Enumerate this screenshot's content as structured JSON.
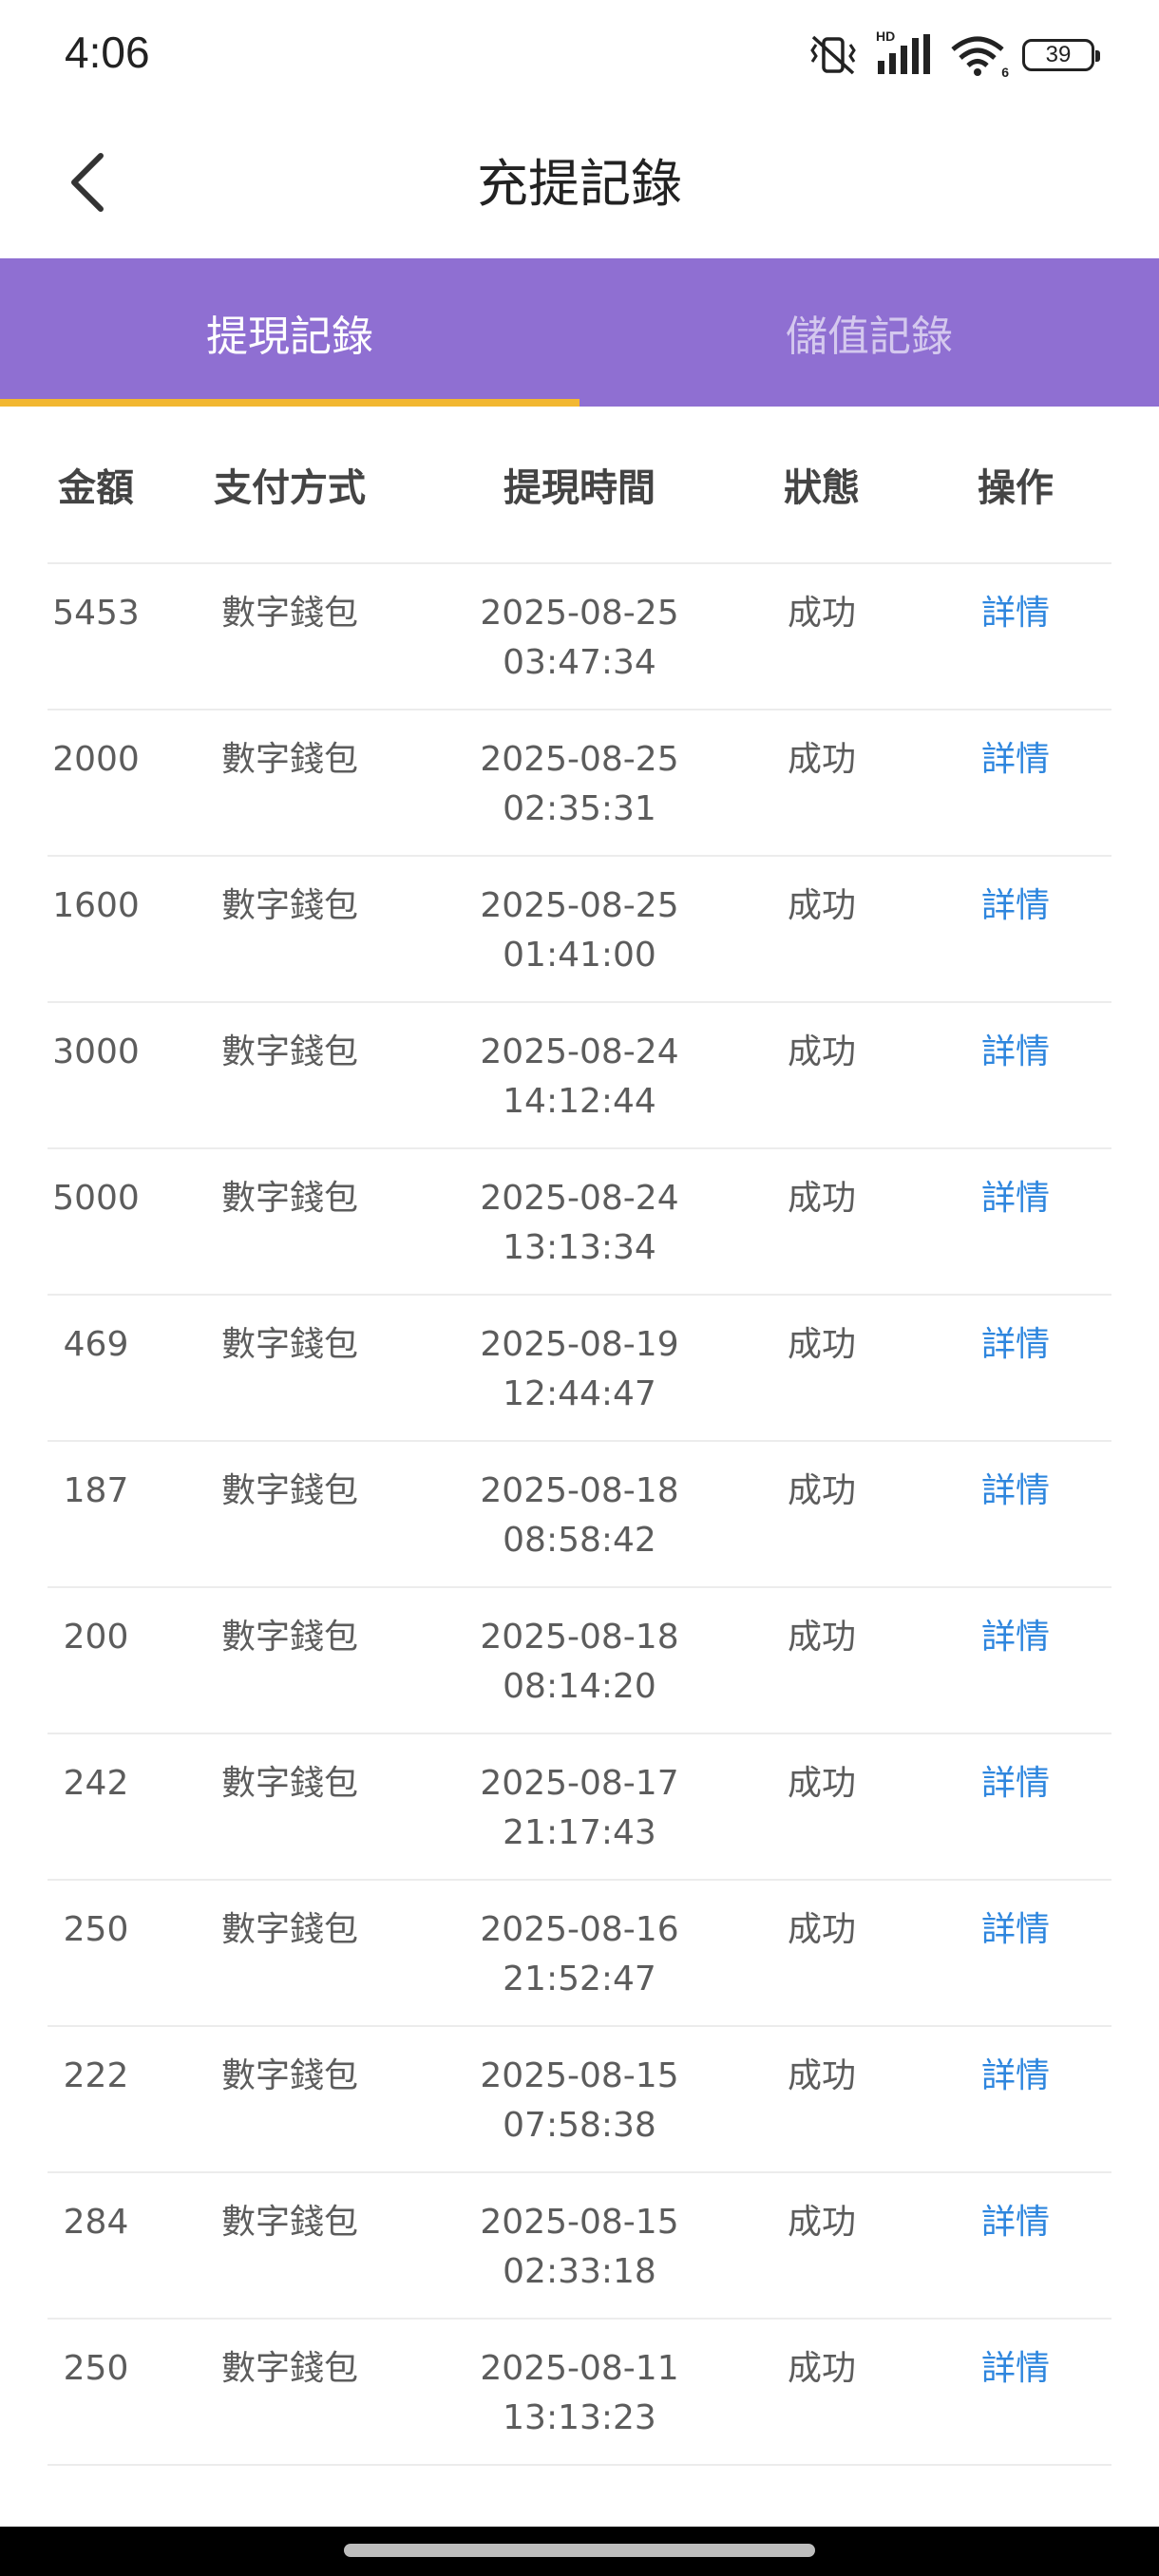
{
  "status_bar": {
    "time": "4:06",
    "hd_label": "HD",
    "wifi_label": "6",
    "battery": "39"
  },
  "nav": {
    "title": "充提記錄",
    "back_icon": "chevron-left-icon"
  },
  "tabs": [
    {
      "label": "提現記錄",
      "active": true
    },
    {
      "label": "儲值記錄",
      "active": false
    }
  ],
  "colors": {
    "tab_bar": "#8f6fd2",
    "indicator": "#f2b731",
    "link": "#2e86de"
  },
  "table": {
    "headers": [
      "金額",
      "支付方式",
      "提現時間",
      "狀態",
      "操作"
    ],
    "rows": [
      {
        "amount": "5453",
        "method": "數字錢包",
        "date": "2025-08-25",
        "clock": "03:47:34",
        "status": "成功",
        "action": "詳情"
      },
      {
        "amount": "2000",
        "method": "數字錢包",
        "date": "2025-08-25",
        "clock": "02:35:31",
        "status": "成功",
        "action": "詳情"
      },
      {
        "amount": "1600",
        "method": "數字錢包",
        "date": "2025-08-25",
        "clock": "01:41:00",
        "status": "成功",
        "action": "詳情"
      },
      {
        "amount": "3000",
        "method": "數字錢包",
        "date": "2025-08-24",
        "clock": "14:12:44",
        "status": "成功",
        "action": "詳情"
      },
      {
        "amount": "5000",
        "method": "數字錢包",
        "date": "2025-08-24",
        "clock": "13:13:34",
        "status": "成功",
        "action": "詳情"
      },
      {
        "amount": "469",
        "method": "數字錢包",
        "date": "2025-08-19",
        "clock": "12:44:47",
        "status": "成功",
        "action": "詳情"
      },
      {
        "amount": "187",
        "method": "數字錢包",
        "date": "2025-08-18",
        "clock": "08:58:42",
        "status": "成功",
        "action": "詳情"
      },
      {
        "amount": "200",
        "method": "數字錢包",
        "date": "2025-08-18",
        "clock": "08:14:20",
        "status": "成功",
        "action": "詳情"
      },
      {
        "amount": "242",
        "method": "數字錢包",
        "date": "2025-08-17",
        "clock": "21:17:43",
        "status": "成功",
        "action": "詳情"
      },
      {
        "amount": "250",
        "method": "數字錢包",
        "date": "2025-08-16",
        "clock": "21:52:47",
        "status": "成功",
        "action": "詳情"
      },
      {
        "amount": "222",
        "method": "數字錢包",
        "date": "2025-08-15",
        "clock": "07:58:38",
        "status": "成功",
        "action": "詳情"
      },
      {
        "amount": "284",
        "method": "數字錢包",
        "date": "2025-08-15",
        "clock": "02:33:18",
        "status": "成功",
        "action": "詳情"
      },
      {
        "amount": "250",
        "method": "數字錢包",
        "date": "2025-08-11",
        "clock": "13:13:23",
        "status": "成功",
        "action": "詳情"
      }
    ]
  }
}
